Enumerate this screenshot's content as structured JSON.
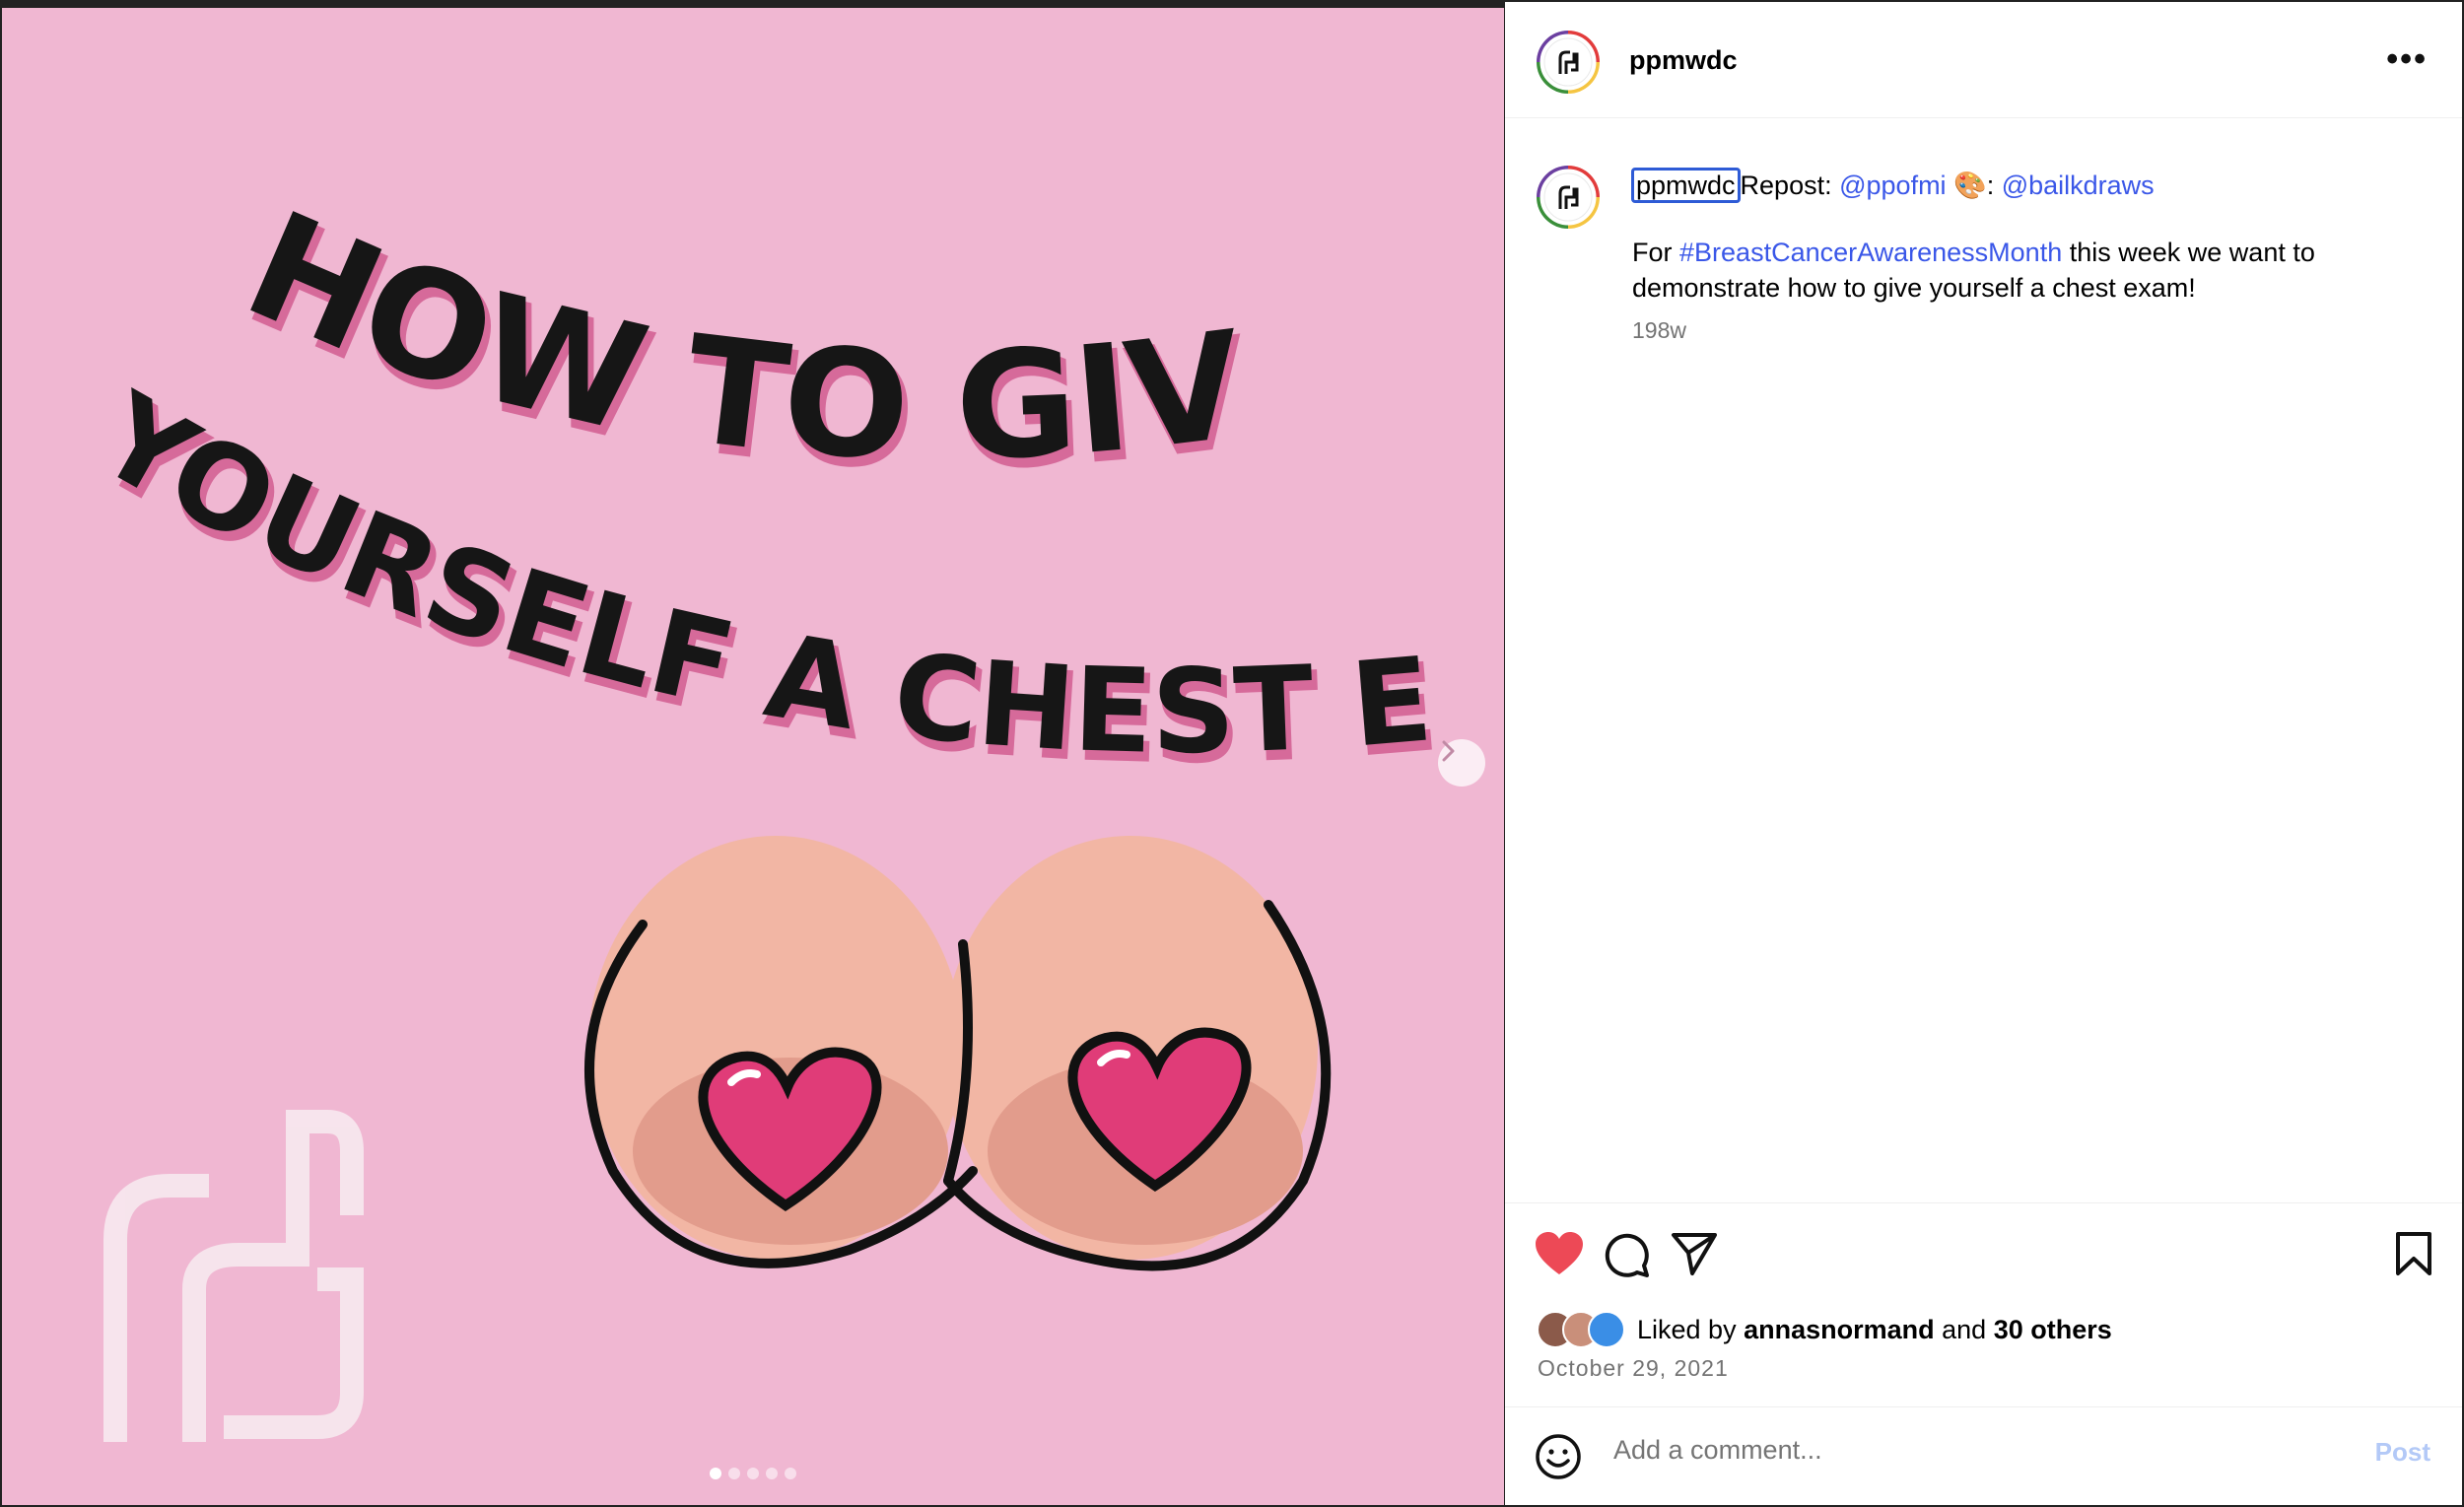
{
  "post": {
    "username": "ppmwdc",
    "more_icon": "more-horizontal-icon",
    "caption_username": "ppmwdc",
    "caption_repost_prefix": "Repost: ",
    "caption_mention_1": "@ppofmi",
    "caption_emoji": "🎨",
    "caption_separator": ": ",
    "caption_mention_2": "@bailkdraws",
    "caption_body_prefix": "For ",
    "caption_hashtag": "#BreastCancerAwarenessMonth",
    "caption_body_suffix": " this week we want to demonstrate how to give yourself a chest exam!",
    "caption_time": "198w",
    "liked_by_prefix": "Liked by ",
    "liked_by_user": "annasnormand",
    "liked_by_and": " and ",
    "liked_by_others": "30 others",
    "date": "October 29, 2021",
    "comment_placeholder": "Add a comment...",
    "post_button": "Post"
  },
  "image": {
    "headline_line_1": "HOW TO GIVE",
    "headline_line_2": "YOURSELF A CHEST EXAM",
    "carousel_count": 5,
    "carousel_active": 1
  },
  "colors": {
    "background_pink": "#f0b7d2",
    "heart_red": "#ed4956",
    "link_blue": "#3a57e8",
    "post_button": "#b3c9f7"
  }
}
